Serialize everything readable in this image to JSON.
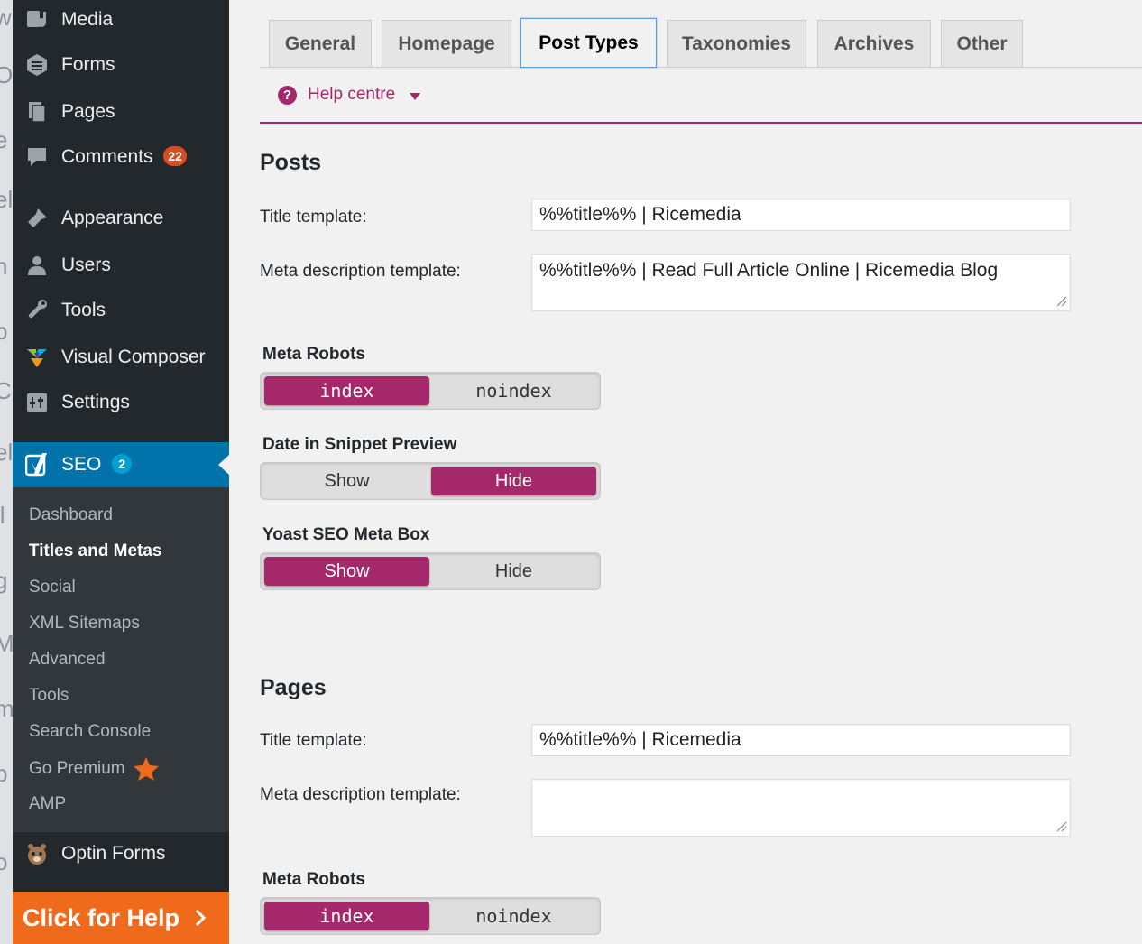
{
  "left_strip": [
    "w",
    "Ol",
    "e",
    "el",
    "n",
    "p",
    "C",
    "eli",
    "ll",
    "g",
    "M",
    "m",
    "b",
    "o"
  ],
  "sidebar": {
    "top_items": [
      {
        "label": "Media",
        "icon": "media-icon"
      },
      {
        "label": "Forms",
        "icon": "forms-icon"
      },
      {
        "label": "Pages",
        "icon": "pages-icon"
      },
      {
        "label": "Comments",
        "icon": "comments-icon",
        "badge": "22"
      }
    ],
    "mid_items": [
      {
        "label": "Appearance",
        "icon": "appearance-icon"
      },
      {
        "label": "Users",
        "icon": "users-icon"
      },
      {
        "label": "Tools",
        "icon": "tools-icon"
      },
      {
        "label": "Visual Composer",
        "icon": "visual-composer-icon"
      },
      {
        "label": "Settings",
        "icon": "settings-icon"
      }
    ],
    "seo": {
      "label": "SEO",
      "badge": "2",
      "icon": "yoast-icon"
    },
    "submenu": [
      {
        "label": "Dashboard",
        "current": false
      },
      {
        "label": "Titles and Metas",
        "current": true
      },
      {
        "label": "Social",
        "current": false
      },
      {
        "label": "XML Sitemaps",
        "current": false
      },
      {
        "label": "Advanced",
        "current": false
      },
      {
        "label": "Tools",
        "current": false
      },
      {
        "label": "Search Console",
        "current": false
      },
      {
        "label": "Go Premium",
        "current": false,
        "icon": "star-icon"
      },
      {
        "label": "AMP",
        "current": false
      }
    ],
    "optin": {
      "label": "Optin Forms",
      "icon": "optin-forms-icon"
    },
    "help_button": {
      "label": "Click for Help",
      "icon": "chevron-right-icon"
    }
  },
  "tabs": [
    {
      "label": "General",
      "active": false
    },
    {
      "label": "Homepage",
      "active": false
    },
    {
      "label": "Post Types",
      "active": true
    },
    {
      "label": "Taxonomies",
      "active": false
    },
    {
      "label": "Archives",
      "active": false
    },
    {
      "label": "Other",
      "active": false
    }
  ],
  "help_centre": {
    "label": "Help centre",
    "icon": "question-icon"
  },
  "colors": {
    "accent": "#a4286a",
    "sidebar_bg": "#23282d",
    "submenu_bg": "#32373c",
    "seo_active": "#0073aa",
    "comments_badge": "#d54e21",
    "seo_badge": "#00a0d2",
    "help_orange": "#f06a1c",
    "star": "#f06a1c"
  },
  "posts": {
    "title": "Posts",
    "title_template": {
      "label": "Title template:",
      "value": "%%title%% | Ricemedia"
    },
    "meta_desc": {
      "label": "Meta description template:",
      "value": "%%title%% | Read Full Article Online | Ricemedia Blog"
    },
    "meta_robots": {
      "label": "Meta Robots",
      "options": [
        "index",
        "noindex"
      ],
      "selected": "index"
    },
    "date_snippet": {
      "label": "Date in Snippet Preview",
      "options": [
        "Show",
        "Hide"
      ],
      "selected": "Hide"
    },
    "meta_box": {
      "label": "Yoast SEO Meta Box",
      "options": [
        "Show",
        "Hide"
      ],
      "selected": "Show"
    }
  },
  "pages": {
    "title": "Pages",
    "title_template": {
      "label": "Title template:",
      "value": "%%title%% | Ricemedia"
    },
    "meta_desc": {
      "label": "Meta description template:",
      "value": ""
    },
    "meta_robots": {
      "label": "Meta Robots",
      "options": [
        "index",
        "noindex"
      ],
      "selected": "index"
    }
  }
}
